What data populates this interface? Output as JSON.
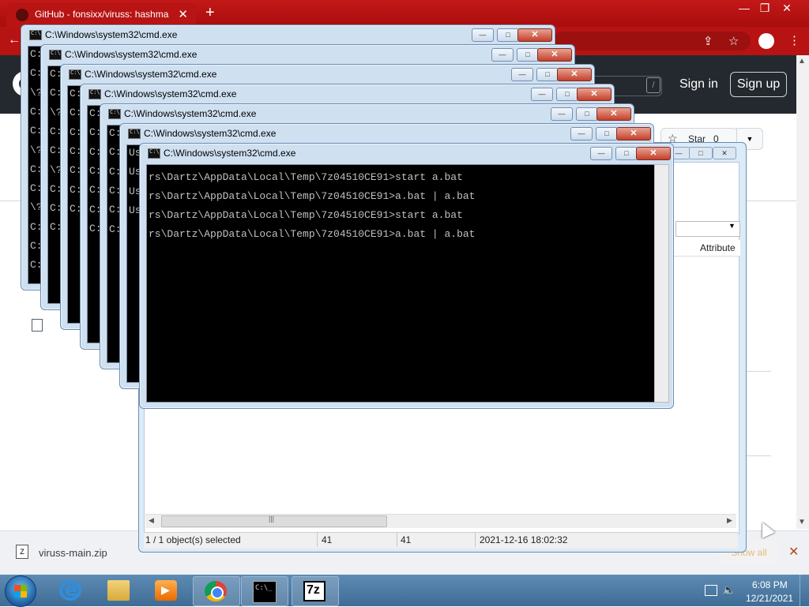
{
  "browser": {
    "tab_title": "GitHub - fonsixx/viruss: hashma",
    "tab_close": "✕",
    "new_tab": "+",
    "window_controls": [
      "—",
      "❐",
      "✕"
    ],
    "back": "←"
  },
  "github": {
    "search_shortcut": "/",
    "sign_in": "Sign in",
    "sign_up": "Sign up",
    "star_label": "Star",
    "star_count": "0",
    "star_dropdown": "▼"
  },
  "download_bar": {
    "file_name": "viruss-main.zip",
    "chevron": "⌃",
    "show_all": "Show all",
    "close": "✕"
  },
  "zip_manager": {
    "column_attribute": "Attribute",
    "status": {
      "selection": "1 / 1 object(s) selected",
      "size": "41",
      "packed": "41",
      "modified": "2021-12-16 18:02:32"
    }
  },
  "cmd_windows": [
    {
      "title": "C:\\Windows\\system32\\cmd.exe",
      "visible_lines": [
        "C:",
        "C:",
        "\\?",
        "C:",
        "C:",
        "\\?",
        "C:",
        "C:",
        "\\?",
        "C:",
        "C:",
        "C:"
      ]
    },
    {
      "title": "C:\\Windows\\system32\\cmd.exe",
      "visible_lines": [
        "C:",
        "C:",
        "\\?",
        "C:",
        "C:",
        "\\?",
        "C:",
        "C:",
        "C:"
      ]
    },
    {
      "title": "C:\\Windows\\system32\\cmd.exe",
      "visible_lines": [
        "C:",
        "C:",
        "C:",
        "C:",
        "C:",
        "C:",
        "C:"
      ]
    },
    {
      "title": "C:\\Windows\\system32\\cmd.exe",
      "visible_lines": [
        "C:",
        "C:",
        "C:",
        "C:",
        "C:",
        "C:",
        "C:"
      ]
    },
    {
      "title": "C:\\Windows\\system32\\cmd.exe",
      "visible_lines": [
        "C:",
        "C:",
        "C:",
        "C:",
        "C:",
        "C:"
      ]
    },
    {
      "title": "C:\\Windows\\system32\\cmd.exe",
      "visible_lines": [
        "Us",
        "Us",
        "Us",
        "Us"
      ]
    },
    {
      "title": "C:\\Windows\\system32\\cmd.exe",
      "visible_lines": [
        "rs\\Dartz\\AppData\\Local\\Temp\\7z04510CE91>start a.bat",
        "rs\\Dartz\\AppData\\Local\\Temp\\7z04510CE91>a.bat | a.bat",
        "rs\\Dartz\\AppData\\Local\\Temp\\7z04510CE91>start a.bat",
        "rs\\Dartz\\AppData\\Local\\Temp\\7z04510CE91>a.bat | a.bat"
      ]
    }
  ],
  "cmd_buttons": {
    "minimize": "—",
    "maximize": "□",
    "close": "✕"
  },
  "taskbar": {
    "apps": [
      "internet-explorer",
      "windows-explorer",
      "media-player",
      "google-chrome",
      "command-prompt",
      "7-zip"
    ],
    "clock_time": "6:08 PM",
    "clock_date": "12/21/2021"
  },
  "icons": {
    "tray_volume": "🔈"
  }
}
